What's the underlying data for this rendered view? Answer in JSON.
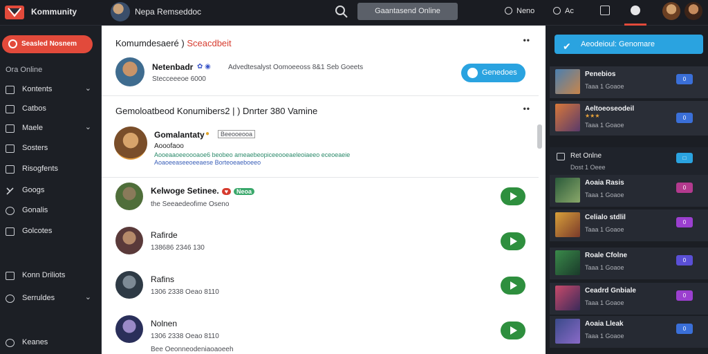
{
  "topbar": {
    "brand": "Kommunity",
    "page_title": "Nepa Remseddoc",
    "online_button": "Gaantasend Online",
    "link_1": "Neno",
    "link_2": "Ac"
  },
  "sidebar": {
    "cta": "Seasled Nosnem",
    "section_label": "Ora Online",
    "items": [
      {
        "label": "Kontents"
      },
      {
        "label": "Catbos"
      },
      {
        "label": "Maele"
      },
      {
        "label": "Sosters"
      },
      {
        "label": "Risogfents"
      },
      {
        "label": "Googs"
      },
      {
        "label": "Gonalis"
      },
      {
        "label": "Golcotes"
      },
      {
        "label": "Konn Driliots"
      },
      {
        "label": "Serruldes"
      },
      {
        "label": "Keanes"
      }
    ]
  },
  "feed": {
    "card1": {
      "title": "Komumdesaeré )",
      "title_red": "Sceacdbeit",
      "name": "Netenbadr",
      "meta": "Advedtesalyst  Oomoeeoss  8&1 Seb Goeets",
      "sub": "Stecceeeoe 6000",
      "button": "Genedoes"
    },
    "card2": {
      "title": "Gemoloatbeod Konumibers2 | ) Dnrter 380 Vamine",
      "name": "Gomalantaty",
      "badge": "Beeooeooa",
      "sub": "Aooofaoo",
      "line1": "Aooeaaoeeoooaoe6 beobeo ameaebeopiceeooeaeleoiaeeo eceoeaeie",
      "line2": "Aoaoeeaseeoeeaese Borteoeaeboeeo"
    },
    "posts": [
      {
        "name": "Kelwoge Setinee.",
        "tag": "Neoa",
        "meta": "the Seeaedeofime Oseno"
      },
      {
        "name": "Rafirde",
        "meta": "138686 2346 130",
        "extra": "130"
      },
      {
        "name": "Rafins",
        "meta": "1306 2338 Oeao 8110",
        "extra": "8110"
      },
      {
        "name": "Nolnen",
        "meta": "1306 2338 Oeao 8110",
        "extra": "8110",
        "sub": "Bee Oeonneodeniaoaoeeh"
      }
    ]
  },
  "right": {
    "cta": "Aeodeioul: Genomare",
    "section_label": "Ret Onlne",
    "section_sub": "Dost 1 Oeee",
    "cards": [
      {
        "name": "Penebios",
        "sub": "Taaa 1 Goaoe",
        "btn": "0",
        "color": "#3a6fd8"
      },
      {
        "name": "Aeltoeoseodeil",
        "sub": "Taaa 1 Goaoe",
        "btn": "0",
        "color": "#3a6fd8"
      },
      {
        "name": "Aoaia Rasis",
        "sub": "Taaa 1 Goaoe",
        "btn": "0",
        "color": "#b33a8e"
      },
      {
        "name": "Celialo stdlil",
        "sub": "Taaa 1 Goaoe",
        "btn": "0",
        "color": "#9b3fcf"
      },
      {
        "name": "Roale Cfolne",
        "sub": "Taaa 1 Goaoe",
        "btn": "0",
        "color": "#5a4fd6"
      },
      {
        "name": "Ceadrd Gnbiale",
        "sub": "Taaa 1 Goaoe",
        "btn": "0",
        "color": "#9b3fcf"
      },
      {
        "name": "Aoaia Lleak",
        "sub": "Taaa 1 Goaoe",
        "btn": "0",
        "color": "#3a6fd8"
      }
    ]
  }
}
